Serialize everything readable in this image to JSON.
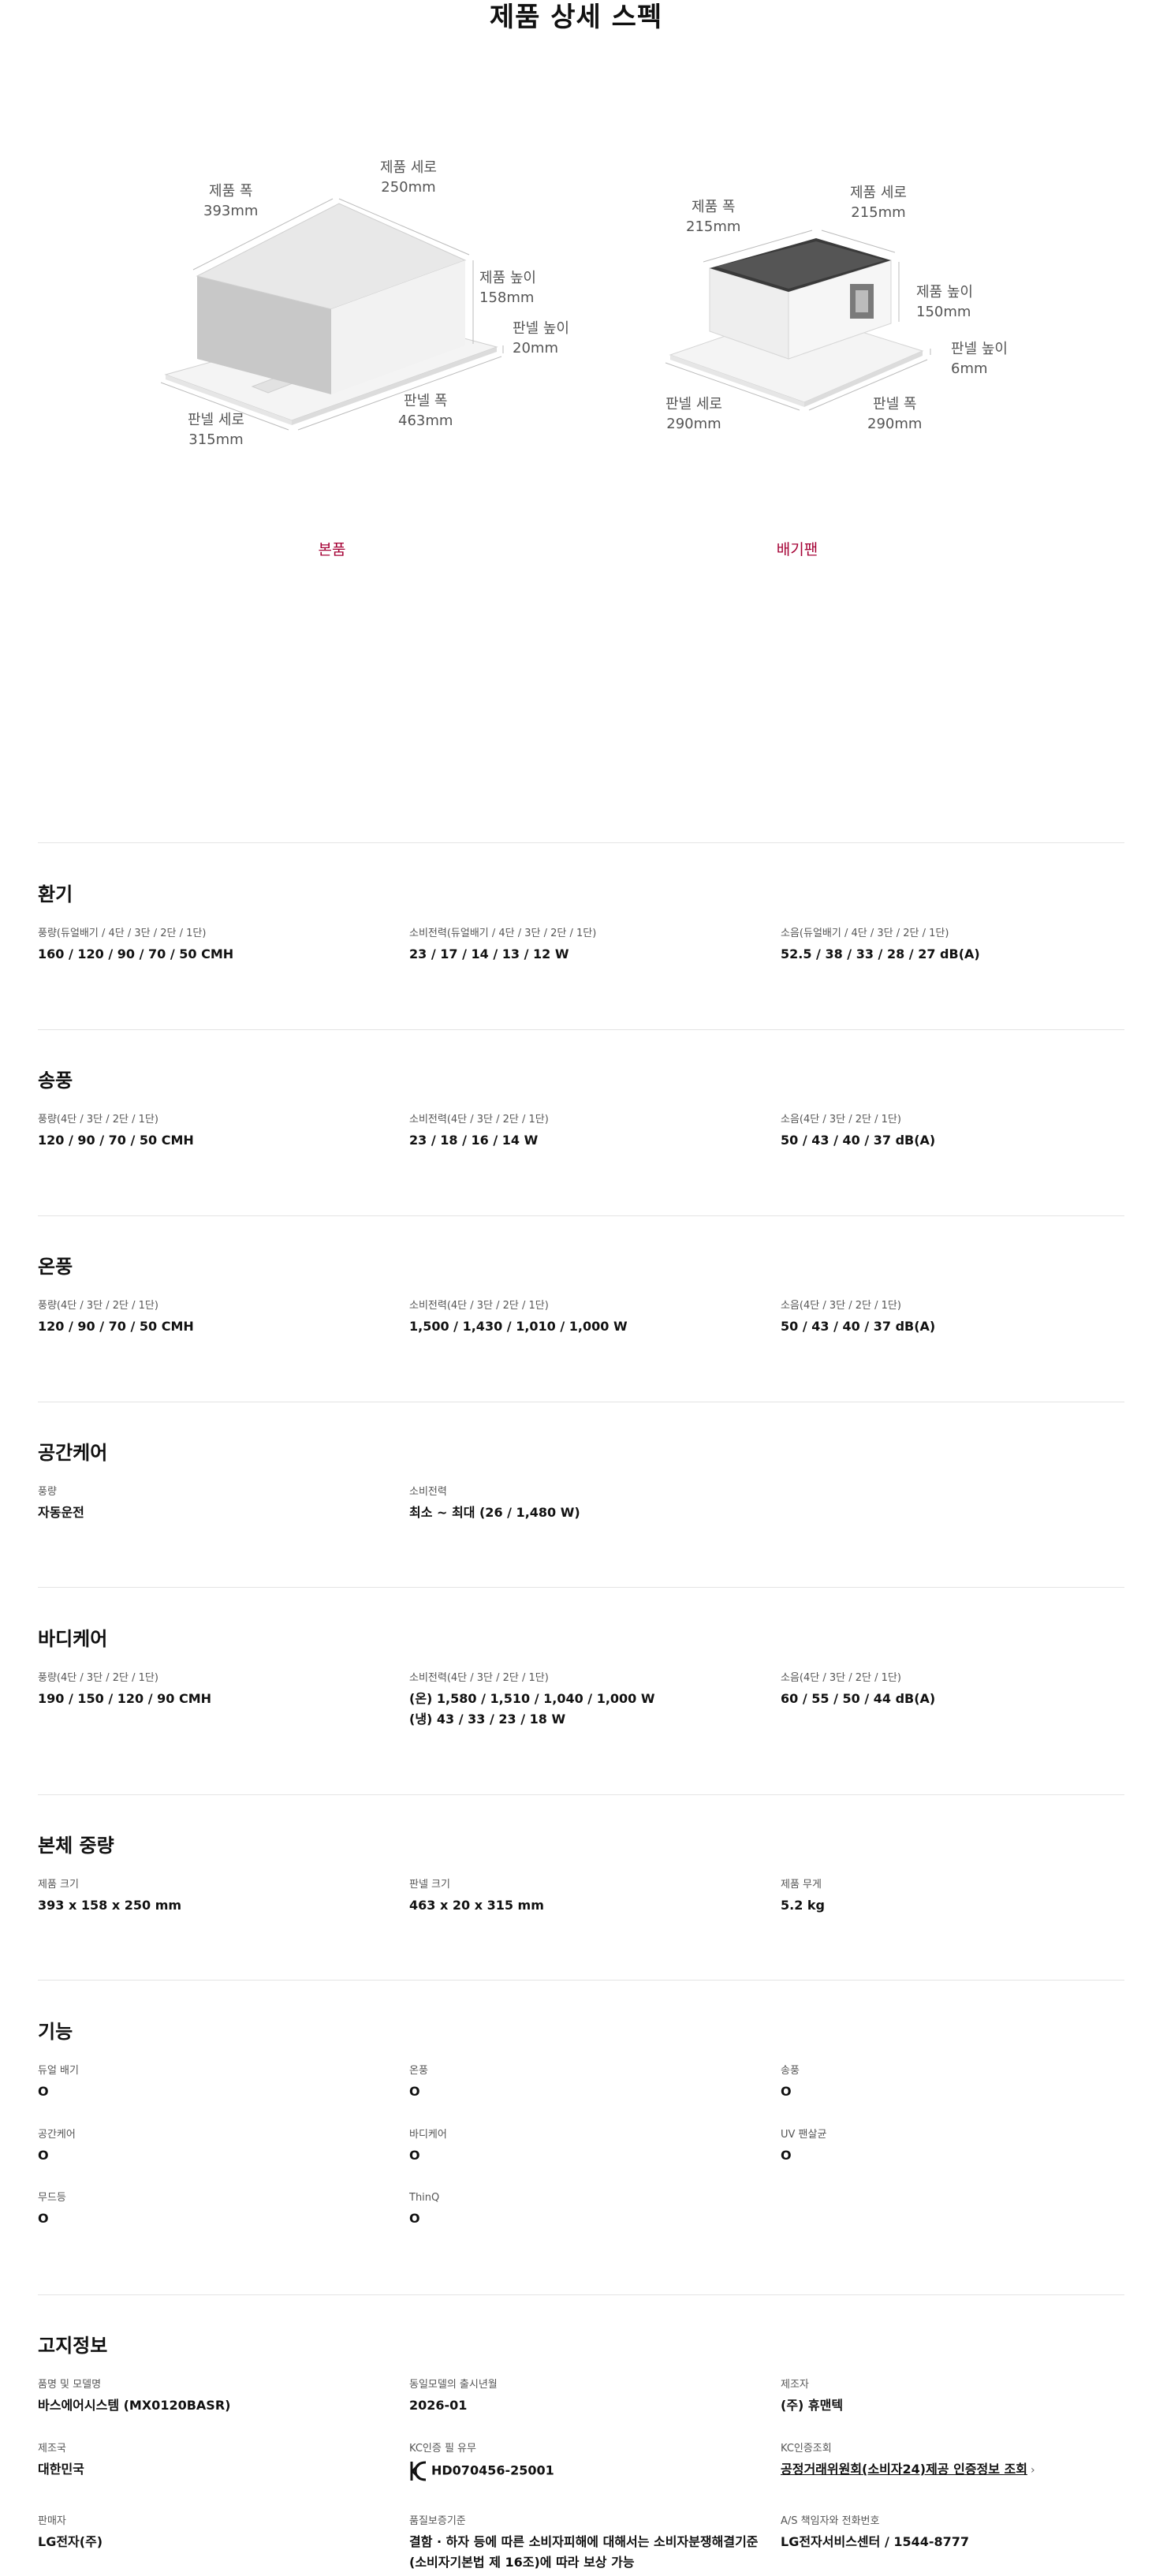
{
  "page_title": "제품 상세 스펙",
  "figures": {
    "main": {
      "caption": "본품",
      "dims": {
        "width_label": "제품 폭",
        "width_value": "393mm",
        "depth_label": "제품 세로",
        "depth_value": "250mm",
        "height_label": "제품 높이",
        "height_value": "158mm",
        "panel_height_label": "판넬 높이",
        "panel_height_value": "20mm",
        "panel_width_label": "판넬 폭",
        "panel_width_value": "463mm",
        "panel_depth_label": "판넬 세로",
        "panel_depth_value": "315mm"
      }
    },
    "exhaust_fan": {
      "caption": "배기팬",
      "dims": {
        "width_label": "제품 폭",
        "width_value": "215mm",
        "depth_label": "제품 세로",
        "depth_value": "215mm",
        "height_label": "제품 높이",
        "height_value": "150mm",
        "panel_height_label": "판넬 높이",
        "panel_height_value": "6mm",
        "panel_width_label": "판넬 폭",
        "panel_width_value": "290mm",
        "panel_depth_label": "판넬 세로",
        "panel_depth_value": "290mm"
      }
    }
  },
  "sections": {
    "ventilation": {
      "title": "환기",
      "items": [
        {
          "label": "풍량(듀얼배기 / 4단 / 3단 / 2단 / 1단)",
          "value": "160 / 120 / 90 / 70 / 50 CMH"
        },
        {
          "label": "소비전력(듀얼배기 / 4단 / 3단 / 2단 / 1단)",
          "value": "23 / 17 / 14 / 13 / 12 W"
        },
        {
          "label": "소음(듀얼배기 / 4단 / 3단 / 2단 / 1단)",
          "value": "52.5 / 38 / 33 / 28 / 27 dB(A)"
        }
      ]
    },
    "blowing": {
      "title": "송풍",
      "items": [
        {
          "label": "풍량(4단 / 3단 / 2단 / 1단)",
          "value": "120 / 90 / 70 / 50 CMH"
        },
        {
          "label": "소비전력(4단 / 3단 / 2단 / 1단)",
          "value": "23 / 18 / 16 / 14 W"
        },
        {
          "label": "소음(4단 / 3단 / 2단 / 1단)",
          "value": "50 / 43 / 40 / 37 dB(A)"
        }
      ]
    },
    "heating": {
      "title": "온풍",
      "items": [
        {
          "label": "풍량(4단 / 3단 / 2단 / 1단)",
          "value": "120 / 90 / 70 / 50 CMH"
        },
        {
          "label": "소비전력(4단 / 3단 / 2단 / 1단)",
          "value": "1,500 / 1,430 / 1,010 / 1,000 W"
        },
        {
          "label": "소음(4단 / 3단 / 2단 / 1단)",
          "value": "50 / 43 / 40 / 37 dB(A)"
        }
      ]
    },
    "space_care": {
      "title": "공간케어",
      "items": [
        {
          "label": "풍량",
          "value": "자동운전"
        },
        {
          "label": "소비전력",
          "value": "최소 ~ 최대 (26 / 1,480 W)"
        }
      ]
    },
    "body_care": {
      "title": "바디케어",
      "items": [
        {
          "label": "풍량(4단 / 3단 / 2단 / 1단)",
          "value": "190 / 150 / 120 / 90 CMH"
        },
        {
          "label": "소비전력(4단 / 3단 / 2단 / 1단)",
          "value": "(온) 1,580 / 1,510 / 1,040 / 1,000 W",
          "value2": "(냉) 43 / 33 / 23 / 18 W"
        },
        {
          "label": "소음(4단 / 3단 / 2단 / 1단)",
          "value": "60 / 55 / 50 / 44 dB(A)"
        }
      ]
    },
    "weight": {
      "title": "본체 중량",
      "items": [
        {
          "label": "제품 크기",
          "value": "393 x 158 x 250 mm"
        },
        {
          "label": "판넬 크기",
          "value": "463 x 20 x 315 mm"
        },
        {
          "label": "제품 무게",
          "value": "5.2 kg"
        }
      ]
    },
    "features": {
      "title": "기능",
      "items": [
        {
          "label": "듀얼 배기",
          "value": "O"
        },
        {
          "label": "온풍",
          "value": "O"
        },
        {
          "label": "송풍",
          "value": "O"
        },
        {
          "label": "공간케어",
          "value": "O"
        },
        {
          "label": "바디케어",
          "value": "O"
        },
        {
          "label": "UV 팬살균",
          "value": "O"
        },
        {
          "label": "무드등",
          "value": "O"
        },
        {
          "label": "ThinQ",
          "value": "O"
        }
      ]
    },
    "notice": {
      "title": "고지정보",
      "items": [
        {
          "label": "품명 및 모델명",
          "value": "바스에어시스템 (MX0120BASR)"
        },
        {
          "label": "동일모델의 출시년월",
          "value": "2026-01"
        },
        {
          "label": "제조자",
          "value": "(주) 휴맨텍"
        },
        {
          "label": "제조국",
          "value": "대한민국"
        },
        {
          "label": "KC인증 필 유무",
          "value": "HD070456-25001"
        },
        {
          "label": "KC인증조회",
          "value": "공정거래위원회(소비자24)제공 인증정보 조회"
        },
        {
          "label": "판매자",
          "value": "LG전자(주)"
        },
        {
          "label": "품질보증기준",
          "value": "결함 · 하자 등에 따른 소비자피해에 대해서는 소비자분쟁해결기준",
          "value2": "(소비자기본법 제 16조)에 따라 보상 가능"
        },
        {
          "label": "A/S 책임자와 전화번호",
          "value": "LG전자서비스센터 / 1544-8777"
        }
      ]
    }
  }
}
